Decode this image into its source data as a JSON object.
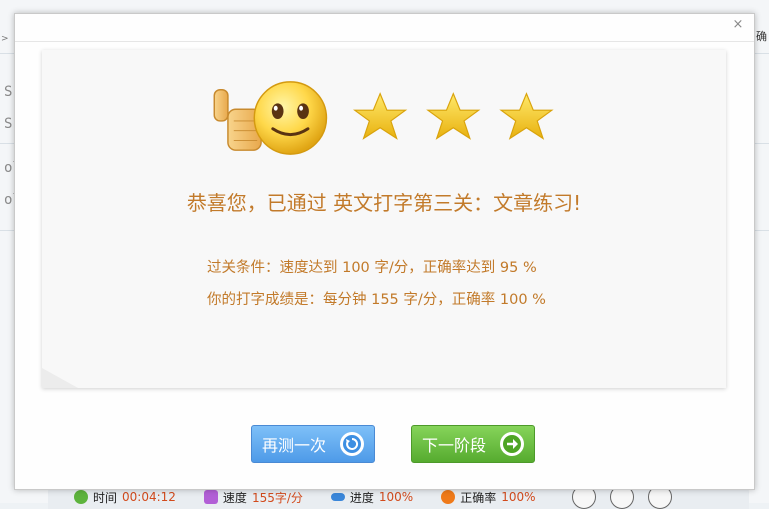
{
  "background": {
    "right_snippet": "确",
    "left_arrow": ">",
    "line_fragments": [
      "S",
      "S",
      "ol",
      "ol"
    ]
  },
  "dialog": {
    "close_label": "×",
    "title": "恭喜您，已通过 英文打字第三关：文章练习!",
    "condition": "过关条件：速度达到 100 字/分，正确率达到 95 %",
    "result": "你的打字成绩是：每分钟 155 字/分，正确率 100 %",
    "stars": 3,
    "buttons": {
      "retry": "再测一次",
      "next": "下一阶段"
    }
  },
  "statusbar": {
    "time_label": "时间",
    "time_value": "00:04:12",
    "speed_label": "速度",
    "speed_value": "155字/分",
    "progress_label": "进度",
    "progress_value": "100%",
    "accuracy_label": "正确率",
    "accuracy_value": "100%"
  },
  "colors": {
    "title_text": "#c27a2a",
    "retry_button": "#5aa5f0",
    "next_button": "#66bb3d",
    "star": "#f2c417"
  }
}
